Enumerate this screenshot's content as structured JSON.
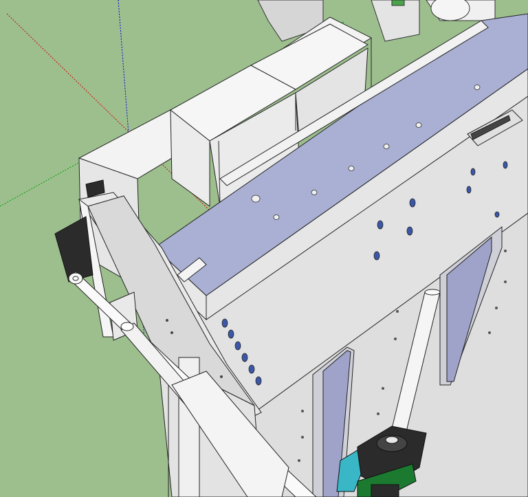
{
  "scene": {
    "background_color": "#9dbf8e",
    "axes": {
      "red": "#d00000",
      "green": "#00a000",
      "blue": "#0000d0"
    },
    "colors": {
      "face_light": "#f1f1f1",
      "face_mid": "#d9d9d9",
      "face_dark": "#bdbdbd",
      "beam_top": "#a9b0d3",
      "beam_side": "#e6e6e6",
      "rail": "#9fa3c9",
      "motor_black": "#2b2b2b",
      "teal": "#39b7c6",
      "pcb_green": "#1b7a2f",
      "rod": "#f7f7f7"
    },
    "objects": [
      "enclosure-blocks",
      "blue-top-beam",
      "front-plate",
      "left-bracket",
      "diagonal-rod",
      "vertical-leadscrew",
      "stepper-motor",
      "linear-rails"
    ]
  }
}
